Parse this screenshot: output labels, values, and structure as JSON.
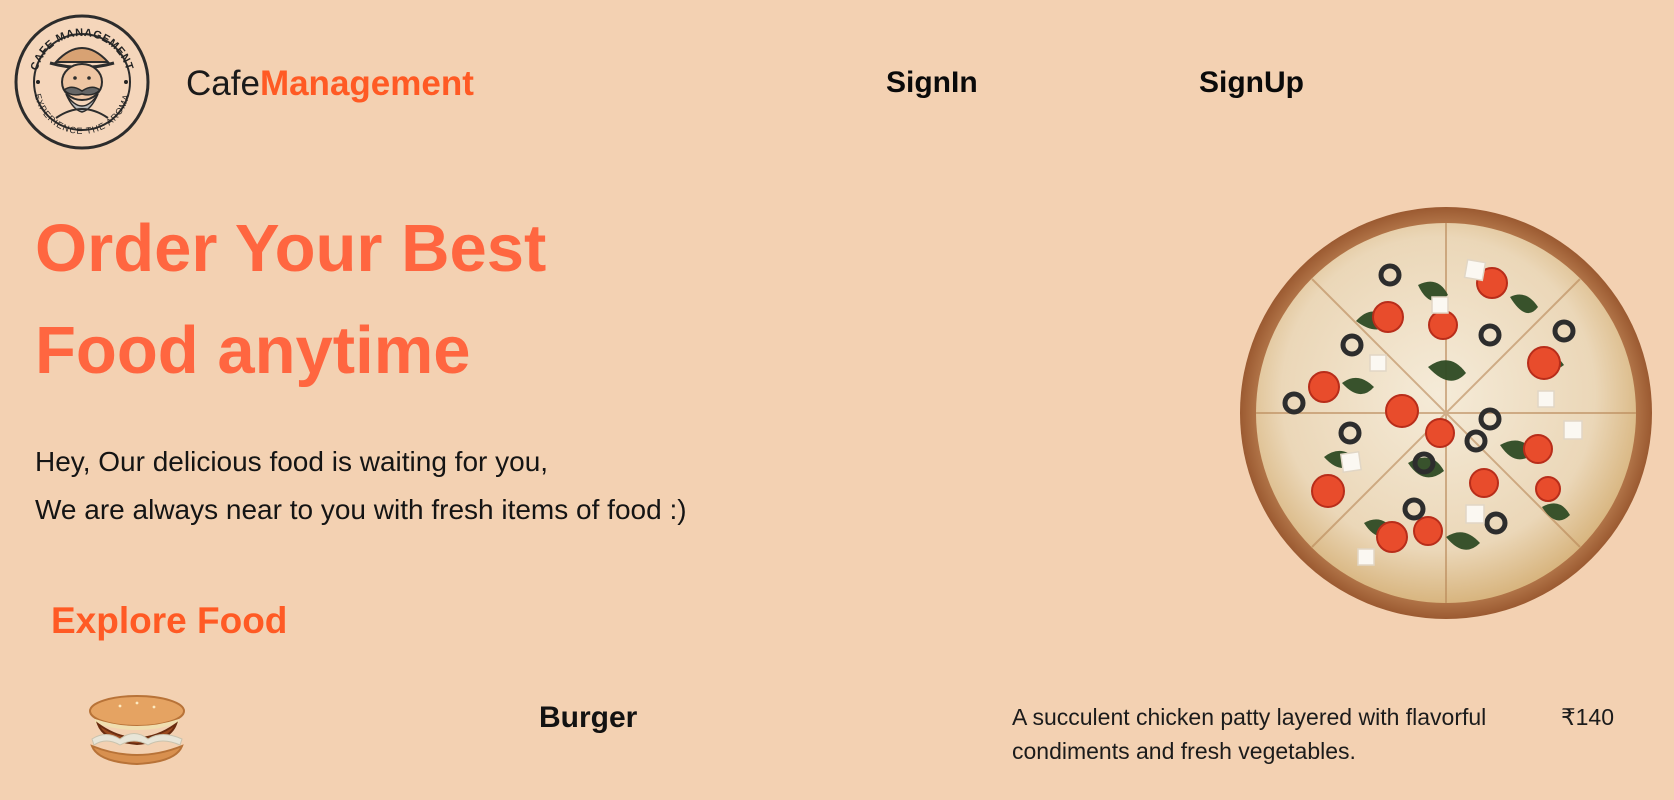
{
  "header": {
    "logo": {
      "top_text": "CAFE MANAGEMENT",
      "bottom_text": "EXPERIENCE THE AROMA",
      "icon": "barista-logo"
    },
    "brand": {
      "part1": "Cafe",
      "part2": "Management"
    },
    "nav": {
      "signin": "SignIn",
      "signup": "SignUp"
    }
  },
  "hero": {
    "title_line1": "Order Your Best",
    "title_line2": "Food anytime",
    "line1": "Hey, Our delicious food is waiting for you,",
    "line2": "We are always near to you with fresh items of food :)",
    "image_icon": "pizza-image"
  },
  "explore": {
    "title": "Explore Food",
    "items": [
      {
        "name": "Burger",
        "description": "A succulent chicken patty layered with flavorful condiments and fresh vegetables.",
        "price": "₹140",
        "image_icon": "burger-image"
      }
    ]
  },
  "colors": {
    "background": "#f3d1b2",
    "accent": "#ff5a24",
    "hero_title": "#ff6640",
    "text": "#111111"
  }
}
